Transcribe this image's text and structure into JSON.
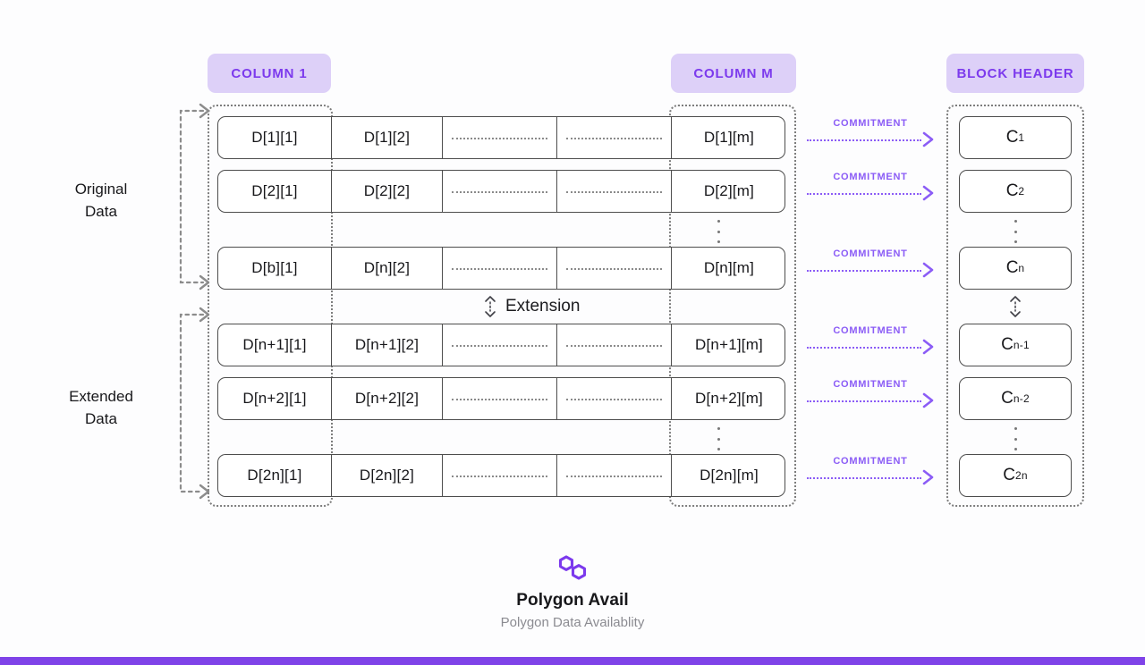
{
  "headers": {
    "column_1": "COLUMN 1",
    "column_m": "COLUMN M",
    "block_header": "BLOCK HEADER"
  },
  "side_labels": {
    "original": "Original\nData",
    "original_line1": "Original",
    "original_line2": "Data",
    "extended_line1": "Extended",
    "extended_line2": "Data"
  },
  "extension_label": "Extension",
  "commitment_label": "COMMITMENT",
  "matrix": {
    "rows": [
      {
        "c1": "D[1][1]",
        "c2": "D[1][2]",
        "mid1": "",
        "mid2": "",
        "cm": "D[1][m]"
      },
      {
        "c1": "D[2][1]",
        "c2": "D[2][2]",
        "mid1": "",
        "mid2": "",
        "cm": "D[2][m]"
      },
      {
        "c1": "D[b][1]",
        "c2": "D[n][2]",
        "mid1": "",
        "mid2": "",
        "cm": "D[n][m]"
      },
      {
        "c1": "D[n+1][1]",
        "c2": "D[n+1][2]",
        "mid1": "",
        "mid2": "",
        "cm": "D[n+1][m]"
      },
      {
        "c1": "D[n+2][1]",
        "c2": "D[n+2][2]",
        "mid1": "",
        "mid2": "",
        "cm": "D[n+2][m]"
      },
      {
        "c1": "D[2n][1]",
        "c2": "D[2n][2]",
        "mid1": "",
        "mid2": "",
        "cm": "D[2n][m]"
      }
    ]
  },
  "commitments": [
    {
      "base": "C",
      "sub": "1"
    },
    {
      "base": "C",
      "sub": "2"
    },
    {
      "base": "C",
      "sub": "n"
    },
    {
      "base": "C",
      "sub": "n-1"
    },
    {
      "base": "C",
      "sub": "n-2"
    },
    {
      "base": "C",
      "sub": "2n"
    }
  ],
  "footer": {
    "brand": "Polygon Avail",
    "tagline": "Polygon Data Availablity"
  },
  "colors": {
    "accent_purple": "#7c3aed",
    "badge_bg": "#ddd0f8",
    "arrow_purple": "#8b5cf6",
    "bottom_bar": "#7f43e8",
    "box_border": "#4d4d4d",
    "dotted_gray": "#7d7d7d",
    "background": "#fdfdfe"
  }
}
